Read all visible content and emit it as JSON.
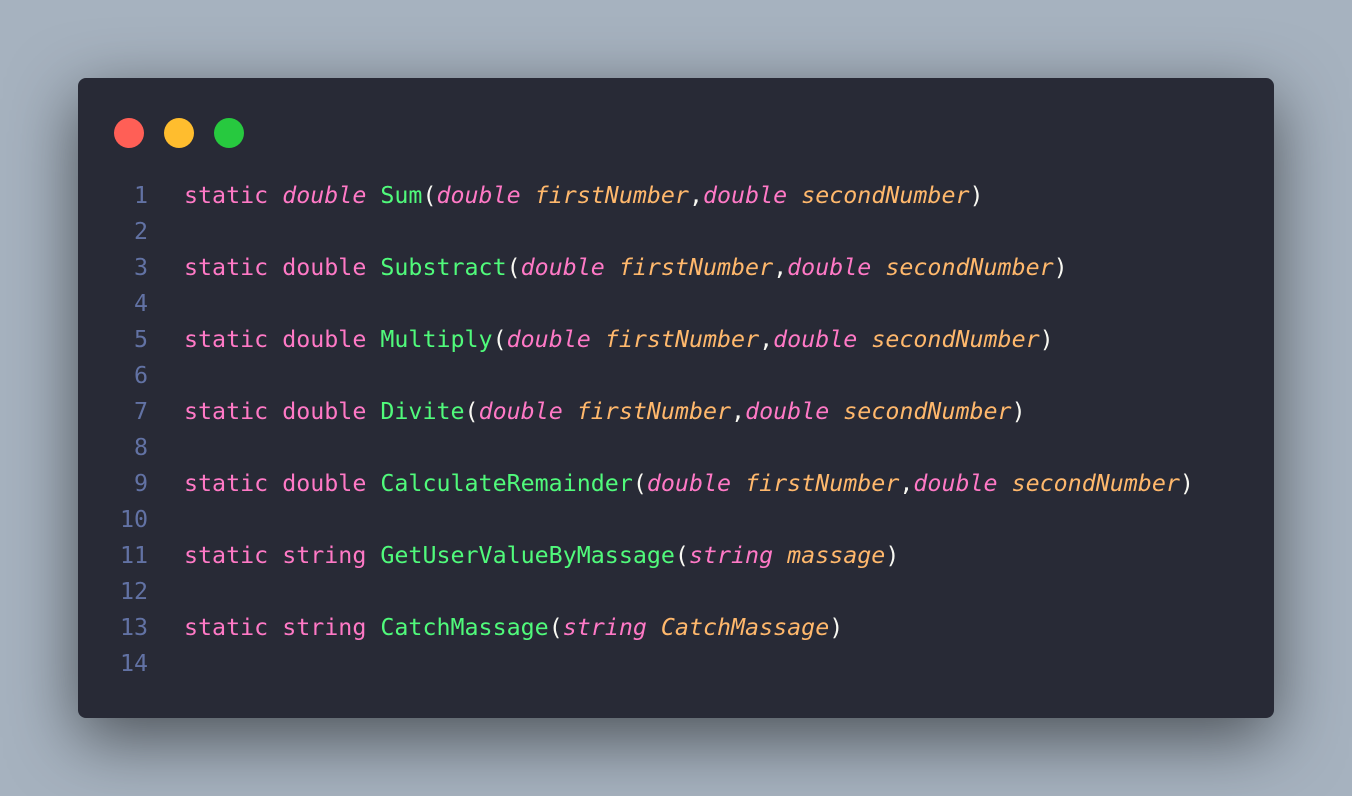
{
  "window": {
    "controls": [
      {
        "name": "close",
        "color": "#ff5f56"
      },
      {
        "name": "minimize",
        "color": "#ffbd2e"
      },
      {
        "name": "zoom",
        "color": "#27c93f"
      }
    ]
  },
  "colors": {
    "keyword": "#ff79c6",
    "function": "#50fa7b",
    "parameter": "#ffb86c",
    "punctuation": "#f8f8f2",
    "line_number": "#6272a4",
    "background": "#282a36"
  },
  "code": {
    "lines": [
      {
        "number": "1",
        "tokens": [
          {
            "text": "static",
            "kind": "keyword"
          },
          {
            "text": " ",
            "kind": "space"
          },
          {
            "text": "double",
            "kind": "keyword",
            "italic": true
          },
          {
            "text": " ",
            "kind": "space"
          },
          {
            "text": "Sum",
            "kind": "function"
          },
          {
            "text": "(",
            "kind": "punctuation"
          },
          {
            "text": "double",
            "kind": "keyword",
            "italic": true
          },
          {
            "text": " ",
            "kind": "space"
          },
          {
            "text": "firstNumber",
            "kind": "parameter",
            "italic": true
          },
          {
            "text": ",",
            "kind": "punctuation"
          },
          {
            "text": "double",
            "kind": "keyword",
            "italic": true
          },
          {
            "text": " ",
            "kind": "space"
          },
          {
            "text": "secondNumber",
            "kind": "parameter",
            "italic": true
          },
          {
            "text": ")",
            "kind": "punctuation"
          }
        ]
      },
      {
        "number": "2",
        "tokens": []
      },
      {
        "number": "3",
        "tokens": [
          {
            "text": "static",
            "kind": "keyword"
          },
          {
            "text": " ",
            "kind": "space"
          },
          {
            "text": "double",
            "kind": "keyword"
          },
          {
            "text": " ",
            "kind": "space"
          },
          {
            "text": "Substract",
            "kind": "function"
          },
          {
            "text": "(",
            "kind": "punctuation"
          },
          {
            "text": "double",
            "kind": "keyword",
            "italic": true
          },
          {
            "text": " ",
            "kind": "space"
          },
          {
            "text": "firstNumber",
            "kind": "parameter",
            "italic": true
          },
          {
            "text": ",",
            "kind": "punctuation"
          },
          {
            "text": "double",
            "kind": "keyword",
            "italic": true
          },
          {
            "text": " ",
            "kind": "space"
          },
          {
            "text": "secondNumber",
            "kind": "parameter",
            "italic": true
          },
          {
            "text": ")",
            "kind": "punctuation"
          }
        ]
      },
      {
        "number": "4",
        "tokens": []
      },
      {
        "number": "5",
        "tokens": [
          {
            "text": "static",
            "kind": "keyword"
          },
          {
            "text": " ",
            "kind": "space"
          },
          {
            "text": "double",
            "kind": "keyword"
          },
          {
            "text": " ",
            "kind": "space"
          },
          {
            "text": "Multiply",
            "kind": "function"
          },
          {
            "text": "(",
            "kind": "punctuation"
          },
          {
            "text": "double",
            "kind": "keyword",
            "italic": true
          },
          {
            "text": " ",
            "kind": "space"
          },
          {
            "text": "firstNumber",
            "kind": "parameter",
            "italic": true
          },
          {
            "text": ",",
            "kind": "punctuation"
          },
          {
            "text": "double",
            "kind": "keyword",
            "italic": true
          },
          {
            "text": " ",
            "kind": "space"
          },
          {
            "text": "secondNumber",
            "kind": "parameter",
            "italic": true
          },
          {
            "text": ")",
            "kind": "punctuation"
          }
        ]
      },
      {
        "number": "6",
        "tokens": []
      },
      {
        "number": "7",
        "tokens": [
          {
            "text": "static",
            "kind": "keyword"
          },
          {
            "text": " ",
            "kind": "space"
          },
          {
            "text": "double",
            "kind": "keyword"
          },
          {
            "text": " ",
            "kind": "space"
          },
          {
            "text": "Divite",
            "kind": "function"
          },
          {
            "text": "(",
            "kind": "punctuation"
          },
          {
            "text": "double",
            "kind": "keyword",
            "italic": true
          },
          {
            "text": " ",
            "kind": "space"
          },
          {
            "text": "firstNumber",
            "kind": "parameter",
            "italic": true
          },
          {
            "text": ",",
            "kind": "punctuation"
          },
          {
            "text": "double",
            "kind": "keyword",
            "italic": true
          },
          {
            "text": " ",
            "kind": "space"
          },
          {
            "text": "secondNumber",
            "kind": "parameter",
            "italic": true
          },
          {
            "text": ")",
            "kind": "punctuation"
          }
        ]
      },
      {
        "number": "8",
        "tokens": []
      },
      {
        "number": "9",
        "tokens": [
          {
            "text": "static",
            "kind": "keyword"
          },
          {
            "text": " ",
            "kind": "space"
          },
          {
            "text": "double",
            "kind": "keyword"
          },
          {
            "text": " ",
            "kind": "space"
          },
          {
            "text": "CalculateRemainder",
            "kind": "function"
          },
          {
            "text": "(",
            "kind": "punctuation"
          },
          {
            "text": "double",
            "kind": "keyword",
            "italic": true
          },
          {
            "text": " ",
            "kind": "space"
          },
          {
            "text": "firstNumber",
            "kind": "parameter",
            "italic": true
          },
          {
            "text": ",",
            "kind": "punctuation"
          },
          {
            "text": "double",
            "kind": "keyword",
            "italic": true
          },
          {
            "text": " ",
            "kind": "space"
          },
          {
            "text": "secondNumber",
            "kind": "parameter",
            "italic": true
          },
          {
            "text": ")",
            "kind": "punctuation"
          }
        ]
      },
      {
        "number": "10",
        "tokens": []
      },
      {
        "number": "11",
        "tokens": [
          {
            "text": "static",
            "kind": "keyword"
          },
          {
            "text": " ",
            "kind": "space"
          },
          {
            "text": "string",
            "kind": "keyword"
          },
          {
            "text": " ",
            "kind": "space"
          },
          {
            "text": "GetUserValueByMassage",
            "kind": "function"
          },
          {
            "text": "(",
            "kind": "punctuation"
          },
          {
            "text": "string",
            "kind": "keyword",
            "italic": true
          },
          {
            "text": " ",
            "kind": "space"
          },
          {
            "text": "massage",
            "kind": "parameter",
            "italic": true
          },
          {
            "text": ")",
            "kind": "punctuation"
          }
        ]
      },
      {
        "number": "12",
        "tokens": []
      },
      {
        "number": "13",
        "tokens": [
          {
            "text": "static",
            "kind": "keyword"
          },
          {
            "text": " ",
            "kind": "space"
          },
          {
            "text": "string",
            "kind": "keyword"
          },
          {
            "text": " ",
            "kind": "space"
          },
          {
            "text": "CatchMassage",
            "kind": "function"
          },
          {
            "text": "(",
            "kind": "punctuation"
          },
          {
            "text": "string",
            "kind": "keyword",
            "italic": true
          },
          {
            "text": " ",
            "kind": "space"
          },
          {
            "text": "CatchMassage",
            "kind": "parameter",
            "italic": true
          },
          {
            "text": ")",
            "kind": "punctuation"
          }
        ]
      },
      {
        "number": "14",
        "tokens": []
      }
    ]
  }
}
